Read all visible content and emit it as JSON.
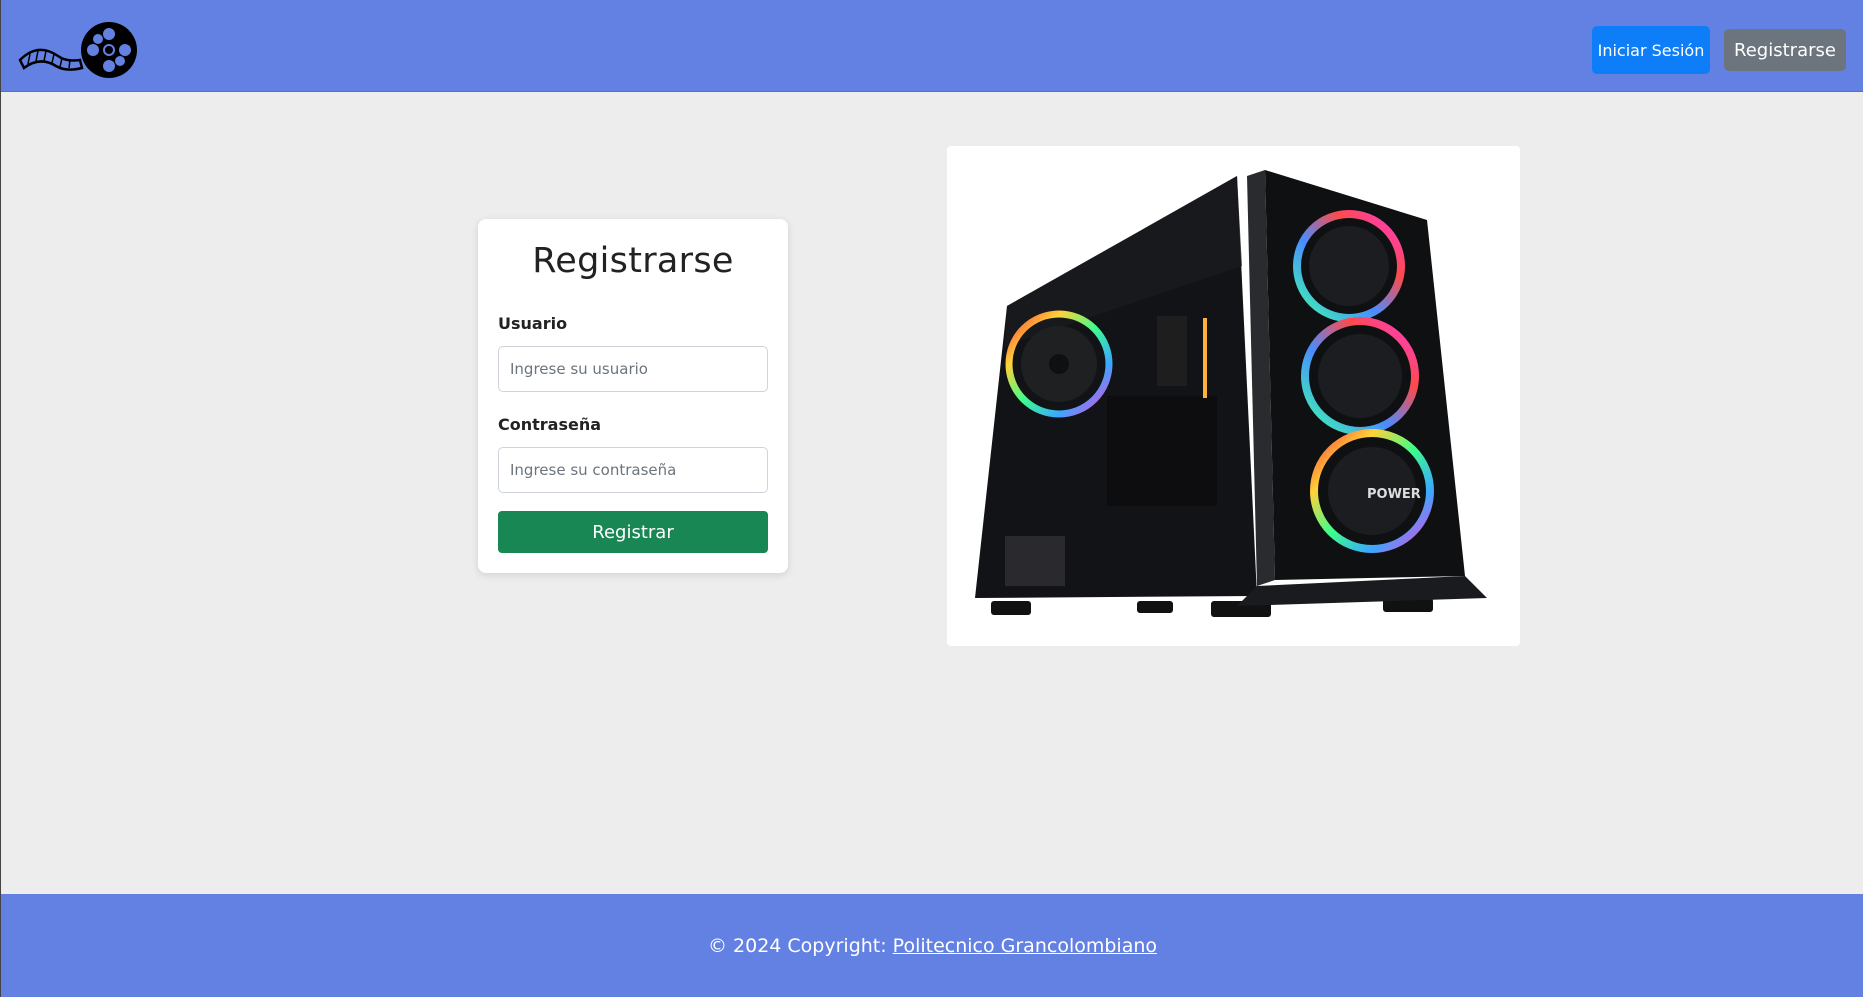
{
  "nav": {
    "login_label": "Iniciar Sesión",
    "register_label": "Registrarse"
  },
  "form": {
    "title": "Registrarse",
    "user_label": "Usuario",
    "user_placeholder": "Ingrese su usuario",
    "user_value": "",
    "password_label": "Contraseña",
    "password_placeholder": "Ingrese su contraseña",
    "password_value": "",
    "submit_label": "Registrar"
  },
  "product_image": {
    "badge_text": "POWER"
  },
  "footer": {
    "copyright": "© 2024 Copyright:",
    "link_text": "Politecnico Grancolombiano"
  },
  "colors": {
    "navbar": "#6380e3",
    "login_button": "#0d7ef8",
    "register_button": "#6c757d",
    "submit_button": "#198754",
    "page_background": "#ededed"
  },
  "icons": {
    "logo": "film-reel-icon"
  }
}
